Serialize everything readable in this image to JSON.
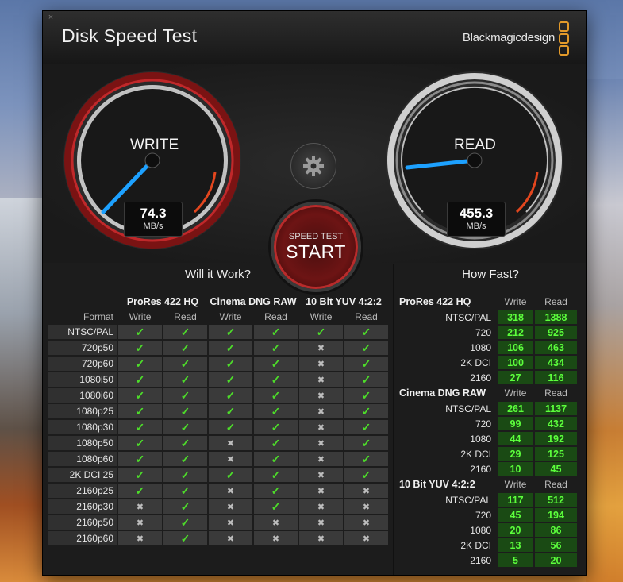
{
  "app": {
    "title": "Disk Speed Test",
    "brand": "Blackmagicdesign",
    "close_glyph": "×"
  },
  "gauges": {
    "write": {
      "label": "WRITE",
      "value": "74.3",
      "unit": "MB/s"
    },
    "read": {
      "label": "READ",
      "value": "455.3",
      "unit": "MB/s"
    }
  },
  "start_button": {
    "small": "SPEED TEST",
    "big": "START"
  },
  "will_it_work": {
    "title": "Will it Work?",
    "format_header": "Format",
    "groups": [
      "ProRes 422 HQ",
      "Cinema DNG RAW",
      "10 Bit YUV 4:2:2"
    ],
    "sub": [
      "Write",
      "Read"
    ],
    "rows": [
      {
        "format": "NTSC/PAL",
        "vals": [
          1,
          1,
          1,
          1,
          1,
          1
        ]
      },
      {
        "format": "720p50",
        "vals": [
          1,
          1,
          1,
          1,
          0,
          1
        ]
      },
      {
        "format": "720p60",
        "vals": [
          1,
          1,
          1,
          1,
          0,
          1
        ]
      },
      {
        "format": "1080i50",
        "vals": [
          1,
          1,
          1,
          1,
          0,
          1
        ]
      },
      {
        "format": "1080i60",
        "vals": [
          1,
          1,
          1,
          1,
          0,
          1
        ]
      },
      {
        "format": "1080p25",
        "vals": [
          1,
          1,
          1,
          1,
          0,
          1
        ]
      },
      {
        "format": "1080p30",
        "vals": [
          1,
          1,
          1,
          1,
          0,
          1
        ]
      },
      {
        "format": "1080p50",
        "vals": [
          1,
          1,
          0,
          1,
          0,
          1
        ]
      },
      {
        "format": "1080p60",
        "vals": [
          1,
          1,
          0,
          1,
          0,
          1
        ]
      },
      {
        "format": "2K DCI 25",
        "vals": [
          1,
          1,
          1,
          1,
          0,
          1
        ]
      },
      {
        "format": "2160p25",
        "vals": [
          1,
          1,
          0,
          1,
          0,
          0
        ]
      },
      {
        "format": "2160p30",
        "vals": [
          0,
          1,
          0,
          1,
          0,
          0
        ]
      },
      {
        "format": "2160p50",
        "vals": [
          0,
          1,
          0,
          0,
          0,
          0
        ]
      },
      {
        "format": "2160p60",
        "vals": [
          0,
          1,
          0,
          0,
          0,
          0
        ]
      }
    ]
  },
  "how_fast": {
    "title": "How Fast?",
    "sub": [
      "Write",
      "Read"
    ],
    "groups": [
      {
        "name": "ProRes 422 HQ",
        "rows": [
          {
            "label": "NTSC/PAL",
            "write": "318",
            "read": "1388"
          },
          {
            "label": "720",
            "write": "212",
            "read": "925"
          },
          {
            "label": "1080",
            "write": "106",
            "read": "463"
          },
          {
            "label": "2K DCI",
            "write": "100",
            "read": "434"
          },
          {
            "label": "2160",
            "write": "27",
            "read": "116"
          }
        ]
      },
      {
        "name": "Cinema DNG RAW",
        "rows": [
          {
            "label": "NTSC/PAL",
            "write": "261",
            "read": "1137"
          },
          {
            "label": "720",
            "write": "99",
            "read": "432"
          },
          {
            "label": "1080",
            "write": "44",
            "read": "192"
          },
          {
            "label": "2K DCI",
            "write": "29",
            "read": "125"
          },
          {
            "label": "2160",
            "write": "10",
            "read": "45"
          }
        ]
      },
      {
        "name": "10 Bit YUV 4:2:2",
        "rows": [
          {
            "label": "NTSC/PAL",
            "write": "117",
            "read": "512"
          },
          {
            "label": "720",
            "write": "45",
            "read": "194"
          },
          {
            "label": "1080",
            "write": "20",
            "read": "86"
          },
          {
            "label": "2K DCI",
            "write": "13",
            "read": "56"
          },
          {
            "label": "2160",
            "write": "5",
            "read": "20"
          }
        ]
      }
    ]
  },
  "icons": {
    "check": "✓",
    "cross": "✖",
    "settings": "gear-icon"
  },
  "colors": {
    "accent_red": "#c0282a",
    "needle_blue": "#1da1ff",
    "ok_green": "#4ddd2a",
    "brand_orange": "#e39a2a"
  }
}
